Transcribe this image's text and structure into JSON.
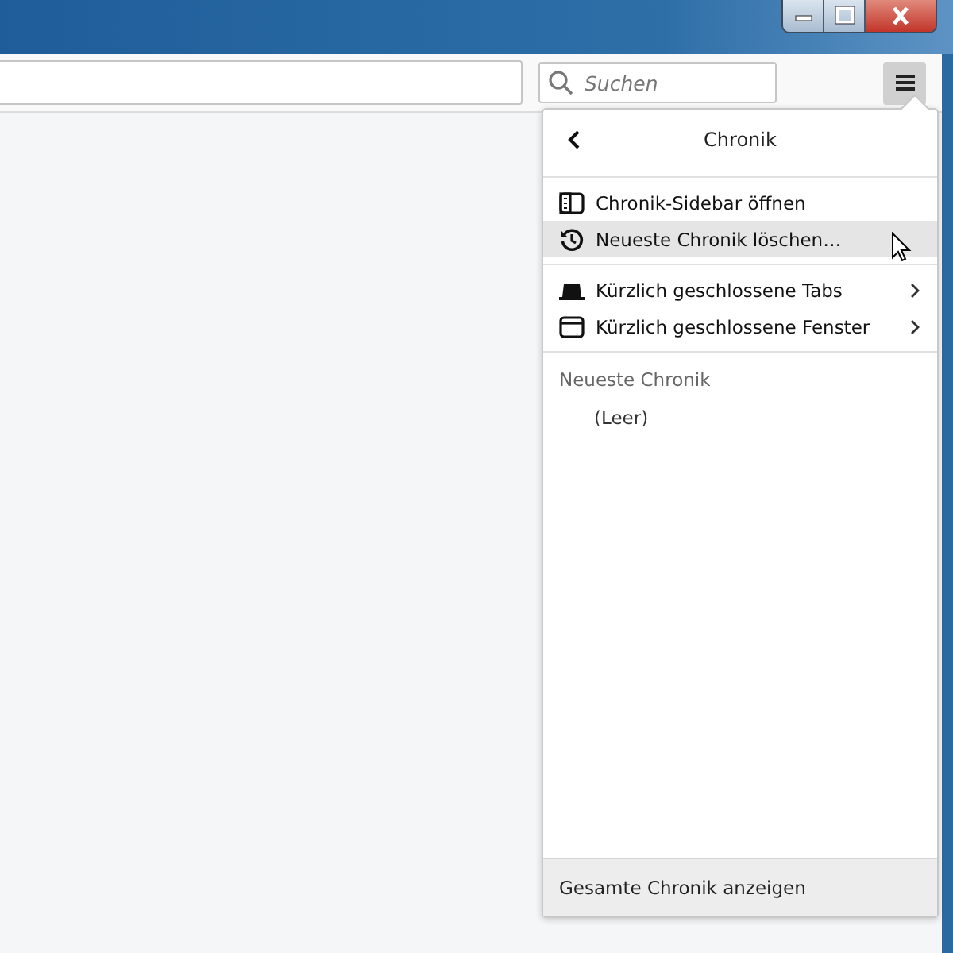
{
  "search": {
    "placeholder": "Suchen"
  },
  "panel": {
    "title": "Chronik",
    "sections": [
      [
        {
          "kind": "sidebar",
          "label": "Chronik-Sidebar öffnen",
          "submenu": false,
          "selected": false
        },
        {
          "kind": "clear",
          "label": "Neueste Chronik löschen…",
          "submenu": false,
          "selected": true
        }
      ],
      [
        {
          "kind": "tabs",
          "label": "Kürzlich geschlossene Tabs",
          "submenu": true,
          "selected": false
        },
        {
          "kind": "windows",
          "label": "Kürzlich geschlossene Fenster",
          "submenu": true,
          "selected": false
        }
      ]
    ],
    "recent_heading": "Neueste Chronik",
    "recent_empty": "(Leer)",
    "footer": "Gesamte Chronik anzeigen"
  }
}
